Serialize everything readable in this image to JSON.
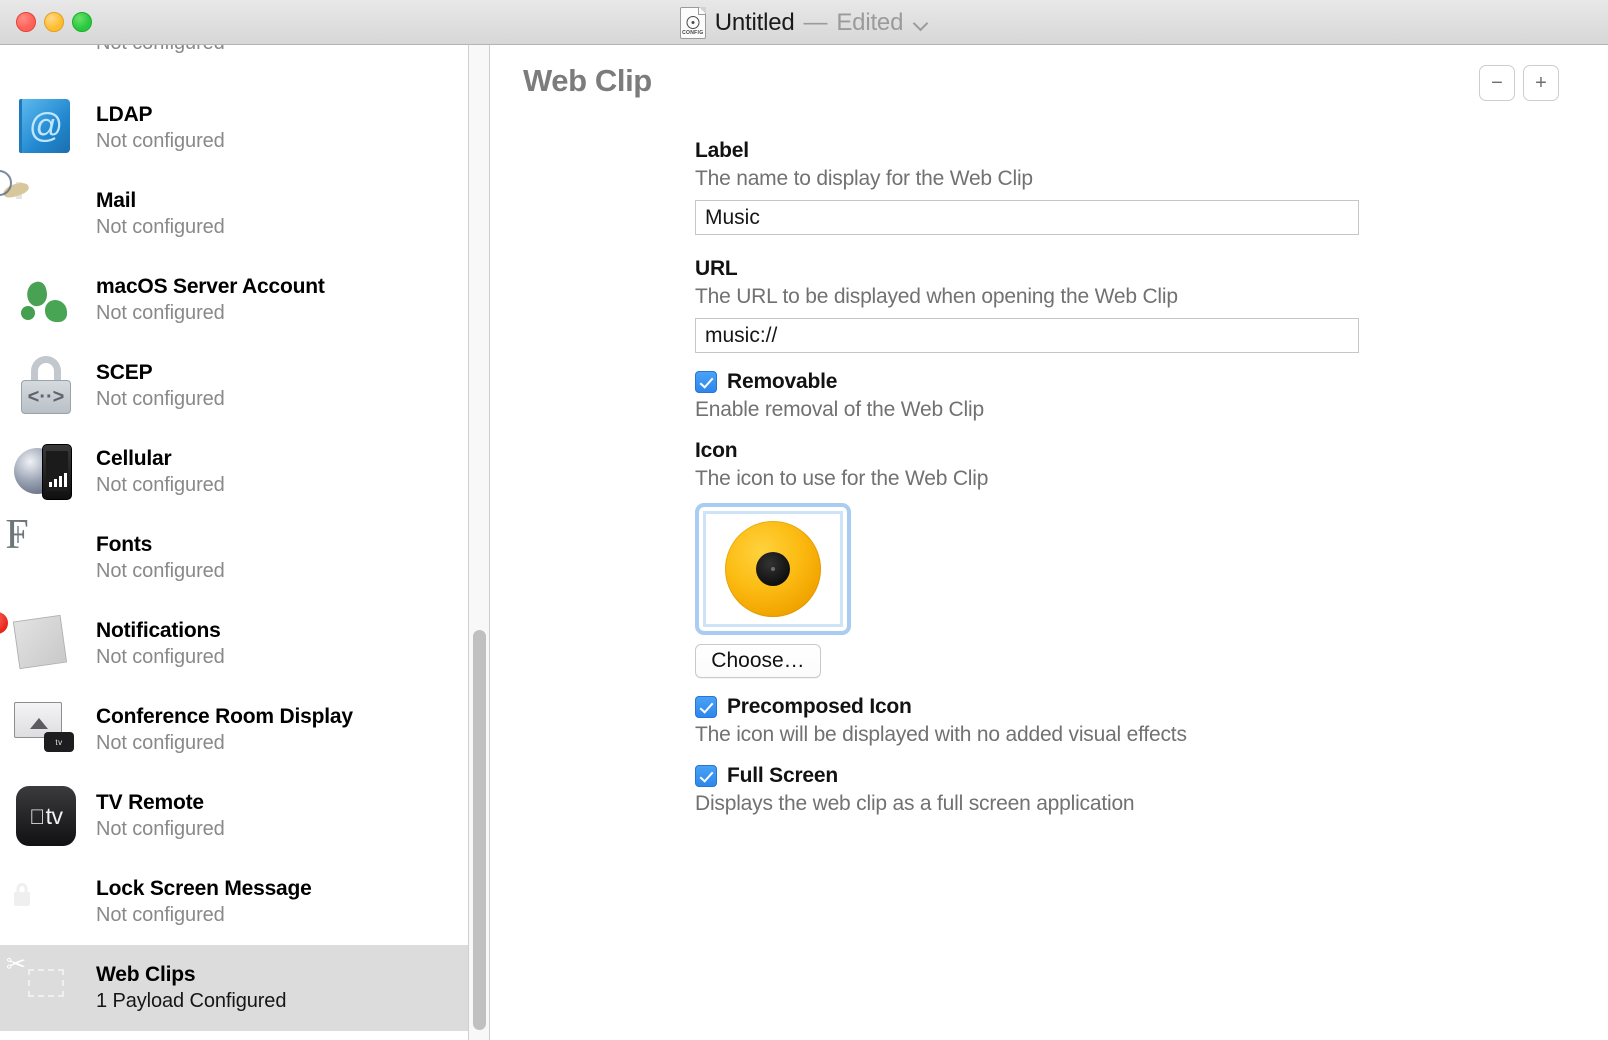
{
  "window": {
    "title": "Untitled",
    "title_separator": "—",
    "title_state": "Edited",
    "doc_icon_caption": "CONFIG",
    "traffic_lights": [
      "close",
      "minimize",
      "zoom"
    ]
  },
  "sidebar": {
    "items": [
      {
        "title": "",
        "subtitle": "Not configured",
        "icon": "google-circle-icon",
        "selected": false,
        "partial": true
      },
      {
        "title": "LDAP",
        "subtitle": "Not configured",
        "icon": "ldap-book-icon",
        "selected": false
      },
      {
        "title": "Mail",
        "subtitle": "Not configured",
        "icon": "mail-stamp-icon",
        "selected": false
      },
      {
        "title": "macOS Server Account",
        "subtitle": "Not configured",
        "icon": "globe-icon",
        "selected": false
      },
      {
        "title": "SCEP",
        "subtitle": "Not configured",
        "icon": "padlock-icon",
        "selected": false
      },
      {
        "title": "Cellular",
        "subtitle": "Not configured",
        "icon": "cellular-phone-icon",
        "selected": false
      },
      {
        "title": "Fonts",
        "subtitle": "Not configured",
        "icon": "font-tile-icon",
        "selected": false
      },
      {
        "title": "Notifications",
        "subtitle": "Not configured",
        "icon": "notification-badge-icon",
        "selected": false
      },
      {
        "title": "Conference Room Display",
        "subtitle": "Not configured",
        "icon": "airplay-display-icon",
        "selected": false
      },
      {
        "title": "TV Remote",
        "subtitle": "Not configured",
        "icon": "apple-tv-icon",
        "selected": false
      },
      {
        "title": "Lock Screen Message",
        "subtitle": "Not configured",
        "icon": "lock-screen-phone-icon",
        "selected": false
      },
      {
        "title": "Web Clips",
        "subtitle": "1 Payload Configured",
        "icon": "scissors-clip-icon",
        "selected": true
      }
    ],
    "apple_tv_glyph": "tv"
  },
  "main": {
    "page_title": "Web Clip",
    "remove_payload_label": "−",
    "add_payload_label": "+",
    "fields": {
      "label": {
        "title": "Label",
        "description": "The name to display for the Web Clip",
        "value": "Music"
      },
      "url": {
        "title": "URL",
        "description": "The URL to be displayed when opening the Web Clip",
        "value": "music://"
      },
      "removable": {
        "title": "Removable",
        "description": "Enable removal of the Web Clip",
        "checked": true
      },
      "icon": {
        "title": "Icon",
        "description": "The icon to use for the Web Clip",
        "preview_icon": "vinyl-record-icon",
        "choose_label": "Choose…"
      },
      "precomposed": {
        "title": "Precomposed Icon",
        "description": "The icon will be displayed with no added visual effects",
        "checked": true
      },
      "fullscreen": {
        "title": "Full Screen",
        "description": "Displays the web clip as a full screen application",
        "checked": true
      }
    }
  },
  "colors": {
    "accent": "#2f86ec",
    "focus_ring": "#a8cdf0",
    "selected_row": "#dcdcdc",
    "vinyl": "#fcbc13",
    "title_dim": "#9b9b9b",
    "page_title": "#7c7c7c"
  }
}
